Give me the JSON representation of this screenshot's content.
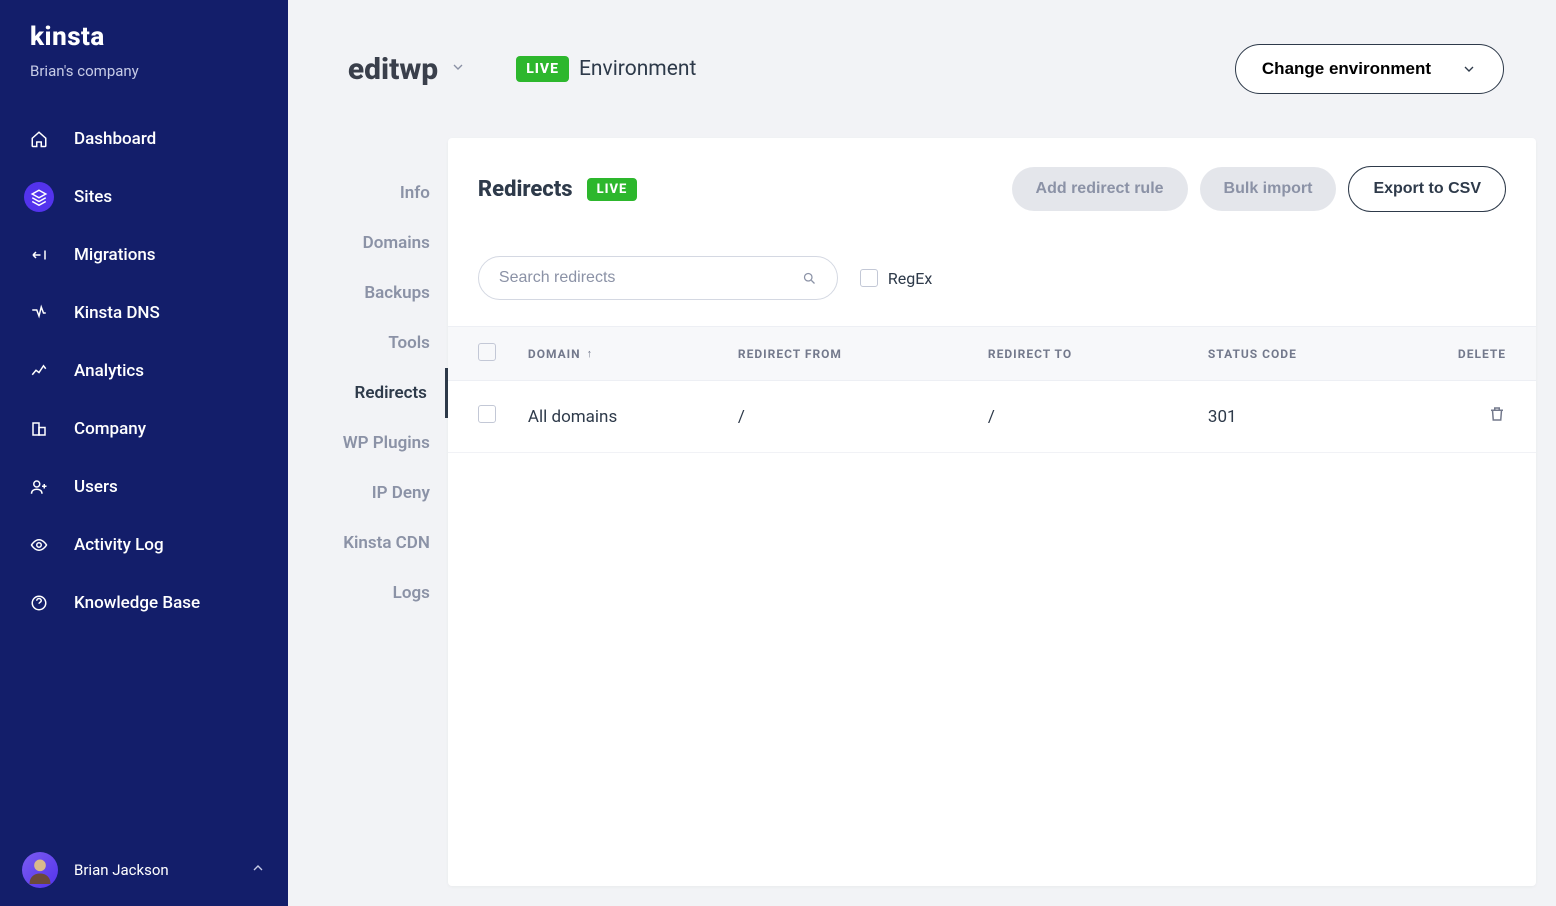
{
  "brand": "kinsta",
  "company_name": "Brian's company",
  "sidebar": {
    "items": [
      {
        "label": "Dashboard"
      },
      {
        "label": "Sites"
      },
      {
        "label": "Migrations"
      },
      {
        "label": "Kinsta DNS"
      },
      {
        "label": "Analytics"
      },
      {
        "label": "Company"
      },
      {
        "label": "Users"
      },
      {
        "label": "Activity Log"
      },
      {
        "label": "Knowledge Base"
      }
    ]
  },
  "user": {
    "name": "Brian Jackson"
  },
  "header": {
    "site_name": "editwp",
    "env_badge": "LIVE",
    "env_label": "Environment",
    "change_env": "Change environment"
  },
  "subnav": {
    "items": [
      {
        "label": "Info"
      },
      {
        "label": "Domains"
      },
      {
        "label": "Backups"
      },
      {
        "label": "Tools"
      },
      {
        "label": "Redirects"
      },
      {
        "label": "WP Plugins"
      },
      {
        "label": "IP Deny"
      },
      {
        "label": "Kinsta CDN"
      },
      {
        "label": "Logs"
      }
    ]
  },
  "panel": {
    "title": "Redirects",
    "live_badge": "LIVE",
    "add_rule": "Add redirect rule",
    "bulk_import": "Bulk import",
    "export_csv": "Export to CSV",
    "search_placeholder": "Search redirects",
    "regex_label": "RegEx"
  },
  "table": {
    "headers": {
      "domain": "DOMAIN",
      "from": "REDIRECT FROM",
      "to": "REDIRECT TO",
      "status": "STATUS CODE",
      "delete": "DELETE"
    },
    "rows": [
      {
        "domain": "All domains",
        "from": "/",
        "to": "/",
        "status": "301"
      }
    ]
  }
}
